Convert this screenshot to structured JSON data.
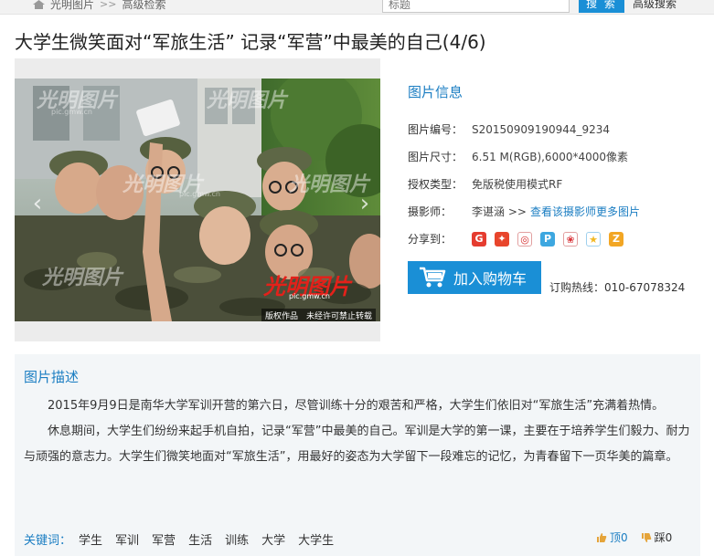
{
  "topbar": {
    "crumb_home": "光明图片",
    "crumb_sep": ">>",
    "crumb_current": "高级检索",
    "search_placeholder": "标题",
    "search_button": "搜 索",
    "advanced_search": "高级搜索"
  },
  "page_title": "大学生微笑面对“军旅生活” 记录“军营”中最美的自己(4/6)",
  "photo": {
    "watermark_brand": "光明图片",
    "watermark_url": "pic.gmw.cn",
    "watermark_copyright": "版权作品　未经许可禁止转载",
    "prev_arrow": "‹",
    "next_arrow": "›"
  },
  "info": {
    "heading": "图片信息",
    "rows": [
      {
        "label": "图片编号：",
        "value": "S20150909190944_9234"
      },
      {
        "label": "图片尺寸：",
        "value": "6.51 M(RGB),6000*4000像素"
      },
      {
        "label": "授权类型：",
        "value": "免版税使用模式RF"
      },
      {
        "label": "摄影师：",
        "value": "李谌涵 >>",
        "link": "查看该摄影师更多图片"
      }
    ],
    "share_label": "分享到：",
    "share_icons": [
      {
        "name": "google-share-icon",
        "color": "#e53c2f",
        "glyph": "G"
      },
      {
        "name": "delicious-share-icon",
        "color": "#e8452c",
        "glyph": "✦"
      },
      {
        "name": "weibo-share-icon",
        "color": "#ffffff",
        "glyph": "◎"
      },
      {
        "name": "qzone-share-icon",
        "color": "#3da7e0",
        "glyph": "P"
      },
      {
        "name": "renren-share-icon",
        "color": "#d9343a",
        "glyph": "❀"
      },
      {
        "name": "star-share-icon",
        "color": "#39a4e8",
        "glyph": "★"
      },
      {
        "name": "kaixin-share-icon",
        "color": "#f2a624",
        "glyph": "Z"
      }
    ]
  },
  "cart": {
    "button_label": "加入购物车",
    "hotline": "订购热线：010-67078324"
  },
  "description": {
    "heading": "图片描述",
    "paragraphs": [
      "2015年9月9日是南华大学军训开营的第六日，尽管训练十分的艰苦和严格，大学生们依旧对“军旅生活”充满着热情。",
      "休息期间，大学生们纷纷来起手机自拍，记录“军营”中最美的自己。军训是大学的第一课，主要在于培养学生们毅力、耐力与顽强的意志力。大学生们微笑地面对“军旅生活”，用最好的姿态为大学留下一段难忘的记忆，为青春留下一页华美的篇章。"
    ],
    "keywords_label": "关键词：",
    "keywords": [
      "学生",
      "军训",
      "军营",
      "生活",
      "训练",
      "大学",
      "大学生"
    ],
    "vote_up": "顶0",
    "vote_down": "踩0"
  }
}
